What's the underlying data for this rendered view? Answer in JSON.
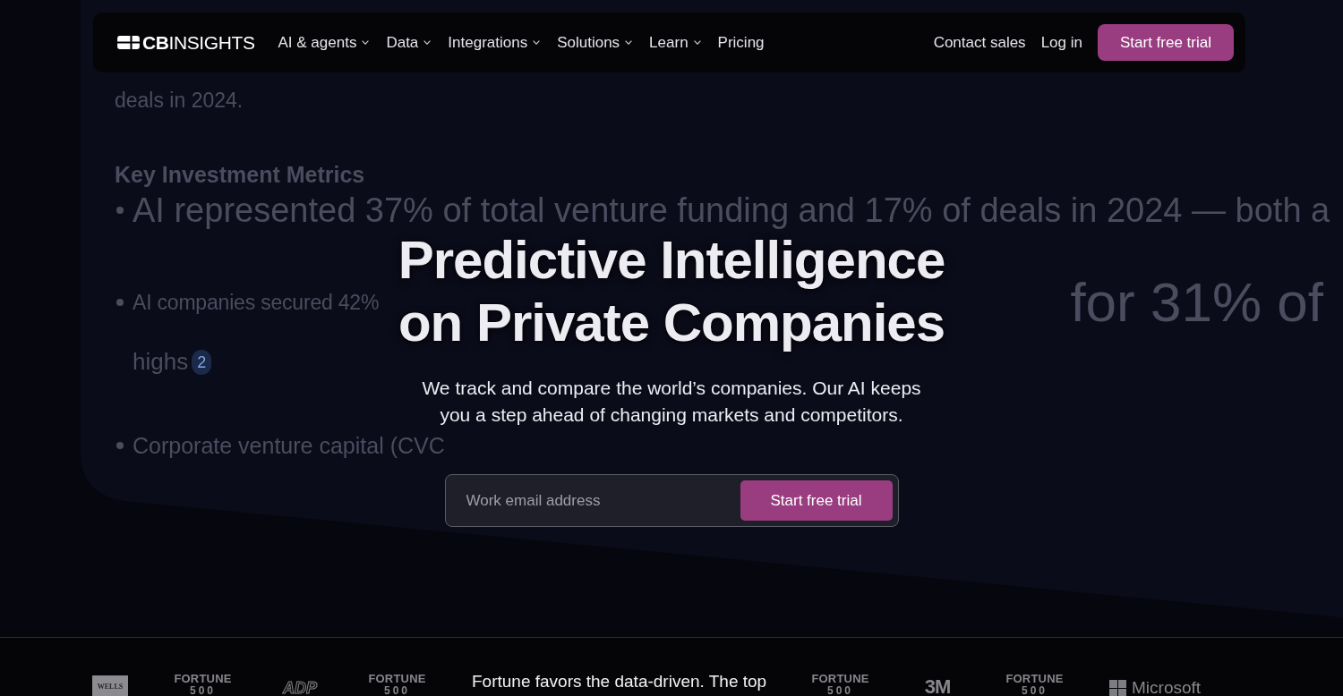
{
  "nav": {
    "logo": "**CB**INSIGHTS",
    "items": [
      {
        "label": "AI & agents",
        "dropdown": true
      },
      {
        "label": "Data",
        "dropdown": true
      },
      {
        "label": "Integrations",
        "dropdown": true
      },
      {
        "label": "Solutions",
        "dropdown": true
      },
      {
        "label": "Learn",
        "dropdown": true
      },
      {
        "label": "Pricing",
        "dropdown": false
      }
    ],
    "links": [
      "Contact sales",
      "Log in"
    ],
    "cta": "Start free trial"
  },
  "backdrop_document": {
    "lines": [
      {
        "kind": "text",
        "text": "deals in 2024."
      },
      {
        "kind": "heading",
        "text": "Key Investment Metrics"
      },
      {
        "kind": "bullet",
        "segments": [
          "AI represented 37% of total venture funding and 17% of deals in 2024 — both a"
        ]
      },
      {
        "kind": "bullet",
        "segments": [
          "AI companies secured 42%",
          "for 31% of"
        ]
      },
      {
        "kind": "continuation",
        "text": "highs",
        "footnote": "2"
      },
      {
        "kind": "bullet",
        "segments": [
          "Corporate venture capital (CVC"
        ]
      }
    ]
  },
  "hero": {
    "title": "Predictive Intelligence on Private Companies",
    "subtitle": "We track and compare the world’s companies. Our AI keeps you a step ahead of changing markets and competitors.",
    "signup": {
      "placeholder": "Work email address",
      "button": "Start free trial"
    }
  },
  "logo_strip": {
    "left": [
      {
        "kind": "tile",
        "text": "WELLS"
      },
      {
        "kind": "fortune",
        "text": "FORTUNE",
        "sub": "500"
      },
      {
        "kind": "outline",
        "text": "ADP"
      },
      {
        "kind": "fortune",
        "text": "FORTUNE",
        "sub": "500"
      }
    ],
    "tagline": "Fortune favors the data-driven. The top",
    "right": [
      {
        "kind": "fortune",
        "text": "FORTUNE",
        "sub": "500"
      },
      {
        "kind": "bold",
        "text": "3M"
      },
      {
        "kind": "fortune",
        "text": "FORTUNE",
        "sub": "500"
      },
      {
        "kind": "squares",
        "text": "Microsoft"
      }
    ]
  }
}
